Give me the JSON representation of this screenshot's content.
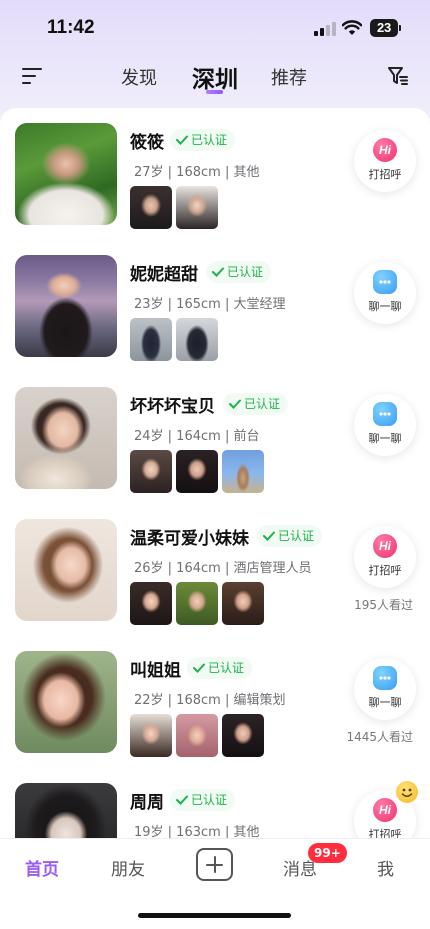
{
  "status_bar": {
    "time": "11:42",
    "battery": "23"
  },
  "header": {
    "tabs": [
      {
        "label": "发现"
      },
      {
        "label": "深圳"
      },
      {
        "label": "推荐"
      }
    ]
  },
  "profiles": [
    {
      "name": "筱筱",
      "verified_label": "已认证",
      "meta": "27岁 | 168cm | 其他",
      "action": "打招呼",
      "action_type": "hi",
      "views": ""
    },
    {
      "name": "妮妮超甜",
      "verified_label": "已认证",
      "meta": "23岁 | 165cm | 大堂经理",
      "action": "聊一聊",
      "action_type": "chat",
      "views": ""
    },
    {
      "name": "坏坏坏宝贝",
      "verified_label": "已认证",
      "meta": "24岁 | 164cm | 前台",
      "action": "聊一聊",
      "action_type": "chat",
      "views": ""
    },
    {
      "name": "温柔可爱小妹妹",
      "verified_label": "已认证",
      "meta": "26岁 | 164cm | 酒店管理人员",
      "action": "打招呼",
      "action_type": "hi",
      "views": "195人看过"
    },
    {
      "name": "叫姐姐",
      "verified_label": "已认证",
      "meta": "22岁 | 168cm | 编辑策划",
      "action": "聊一聊",
      "action_type": "chat",
      "views": "1445人看过"
    },
    {
      "name": "周周",
      "verified_label": "已认证",
      "meta": "19岁 | 163cm | 其他",
      "action": "打招呼",
      "action_type": "hi",
      "views": ""
    }
  ],
  "action_icons": {
    "hi": "Hi",
    "chat": "chat-bubble-icon"
  },
  "bottom_nav": {
    "home": "首页",
    "friends": "朋友",
    "messages": "消息",
    "messages_badge": "99+",
    "me": "我"
  },
  "colors": {
    "accent": "#9b5cf5",
    "verified": "#1eb24a",
    "badge": "#ff2d3d"
  }
}
